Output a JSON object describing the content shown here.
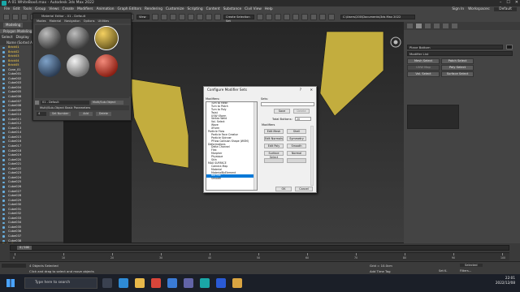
{
  "window": {
    "title": "A 01 WhiteBox4.max - Autodesk 3ds Max 2022",
    "controls": [
      "–",
      "☐",
      "✕"
    ]
  },
  "menubar": {
    "items": [
      "File",
      "Edit",
      "Tools",
      "Group",
      "Views",
      "Create",
      "Modifiers",
      "Animation",
      "Graph Editors",
      "Rendering",
      "Customize",
      "Scripting",
      "Content",
      "Substance",
      "Civil View",
      "Help"
    ],
    "sign_in": "Sign In",
    "workspaces_label": "Workspaces:",
    "workspaces_value": "Default"
  },
  "toolbar": {
    "filter_value": "All",
    "view_value": "View",
    "selection_set_placeholder": "Create Selection Set",
    "path": "C:\\Users\\200\\Documents\\3ds Max 2022"
  },
  "ribbon": {
    "tabs": [
      "Modeling"
    ],
    "sub": "Polygon Modeling"
  },
  "scene_explorer": {
    "tabs": [
      "Select",
      "Display",
      "Ed"
    ],
    "header": "Name (Sorted Ascending)",
    "items": [
      {
        "label": "Brick01",
        "selected": true
      },
      {
        "label": "Brick02",
        "selected": true
      },
      {
        "label": "Brick03",
        "selected": true
      },
      {
        "label": "Brick04",
        "selected": true
      },
      {
        "label": "Brick05",
        "selected": true
      },
      {
        "label": "Cone_01",
        "selected": false
      },
      {
        "label": "Cube001",
        "selected": false
      },
      {
        "label": "Cube002",
        "selected": false
      },
      {
        "label": "Cube003",
        "selected": false
      },
      {
        "label": "Cube004",
        "selected": false
      },
      {
        "label": "Cube005",
        "selected": false
      },
      {
        "label": "Cube006",
        "selected": false
      },
      {
        "label": "Cube007",
        "selected": false
      },
      {
        "label": "Cube008",
        "selected": false
      },
      {
        "label": "Cube009",
        "selected": false
      },
      {
        "label": "Cube010",
        "selected": false
      },
      {
        "label": "Cube011",
        "selected": false
      },
      {
        "label": "Cube012",
        "selected": false
      },
      {
        "label": "Cube013",
        "selected": false
      },
      {
        "label": "Cube014",
        "selected": false
      },
      {
        "label": "Cube015",
        "selected": false
      },
      {
        "label": "Cube016",
        "selected": false
      },
      {
        "label": "Cube017",
        "selected": false
      },
      {
        "label": "Cube018",
        "selected": false
      },
      {
        "label": "Cube019",
        "selected": false
      },
      {
        "label": "Cube020",
        "selected": false
      },
      {
        "label": "Cube021",
        "selected": false
      },
      {
        "label": "Cube022",
        "selected": false
      },
      {
        "label": "Cube023",
        "selected": false
      },
      {
        "label": "Cube024",
        "selected": false
      },
      {
        "label": "Cube025",
        "selected": false
      },
      {
        "label": "Cube026",
        "selected": false
      },
      {
        "label": "Cube027",
        "selected": false
      },
      {
        "label": "Cube028",
        "selected": false
      },
      {
        "label": "Cube029",
        "selected": false
      },
      {
        "label": "Cube030",
        "selected": false
      },
      {
        "label": "Cube031",
        "selected": false
      },
      {
        "label": "Cube032",
        "selected": false
      },
      {
        "label": "Cube033",
        "selected": false
      },
      {
        "label": "Cube034",
        "selected": false
      },
      {
        "label": "Cube035",
        "selected": false
      },
      {
        "label": "Cube036",
        "selected": false
      },
      {
        "label": "Cube037",
        "selected": false
      },
      {
        "label": "Cube038",
        "selected": false
      }
    ],
    "footer": "Default"
  },
  "material_editor": {
    "title": "Material Editor - 01 - Default",
    "menu": [
      "Modes",
      "Material",
      "Navigation",
      "Options",
      "Utilities"
    ],
    "material_name": "01 - Default",
    "material_type": "Multi/Sub-Object",
    "rollout": "Multi/Sub-Object Basic Parameters",
    "count": "4",
    "set_number": "Set Number",
    "add": "Add",
    "delete": "Delete"
  },
  "dialog": {
    "title": "Configure Modifier Sets",
    "help": "?",
    "close": "✕",
    "modifiers_label": "Modifiers:",
    "sets_label": "Sets:",
    "save": "Save",
    "delete": "Delete",
    "total_buttons_label": "Total Buttons:",
    "total_buttons_value": "20",
    "modifiers_group": "Modifiers",
    "grid_buttons": [
      "Edit Mesh",
      "Shell",
      "Edit Normals",
      "Symmetry",
      "Edit Poly",
      "Smooth",
      "Surface Select",
      "Normal",
      "",
      ""
    ],
    "list": [
      {
        "label": "Turn to Mesh",
        "cat": false,
        "selected": false
      },
      {
        "label": "Turn to Patch",
        "cat": false,
        "selected": false
      },
      {
        "label": "Turn to Poly",
        "cat": false,
        "selected": false
      },
      {
        "label": "Twist",
        "cat": false,
        "selected": false
      },
      {
        "label": "UVW Xform",
        "cat": false,
        "selected": false
      },
      {
        "label": "Vertex Weld",
        "cat": false,
        "selected": false
      },
      {
        "label": "Vol. Select",
        "cat": false,
        "selected": false
      },
      {
        "label": "Wave",
        "cat": false,
        "selected": false
      },
      {
        "label": "XForm",
        "cat": false,
        "selected": false
      },
      {
        "label": "Particle Flow",
        "cat": true,
        "selected": false
      },
      {
        "label": "Particle Face Creator",
        "cat": false,
        "selected": false
      },
      {
        "label": "Particle Skinner",
        "cat": false,
        "selected": false
      },
      {
        "label": "PFlow Collision Shape (WSM)",
        "cat": false,
        "selected": false
      },
      {
        "label": "Deformations",
        "cat": true,
        "selected": false
      },
      {
        "label": "Delta Channel",
        "cat": false,
        "selected": false
      },
      {
        "label": "Flex",
        "cat": false,
        "selected": false
      },
      {
        "label": "Morpher",
        "cat": false,
        "selected": false
      },
      {
        "label": "Physique",
        "cat": false,
        "selected": false
      },
      {
        "label": "Skin",
        "cat": false,
        "selected": false
      },
      {
        "label": "MAX SURFACE",
        "cat": true,
        "selected": false
      },
      {
        "label": "Camera Map",
        "cat": false,
        "selected": false
      },
      {
        "label": "Material",
        "cat": false,
        "selected": false
      },
      {
        "label": "MaterialByElement",
        "cat": false,
        "selected": false
      },
      {
        "label": "Normal",
        "cat": false,
        "selected": true
      },
      {
        "label": "Smooth",
        "cat": false,
        "selected": false
      }
    ],
    "ok": "OK",
    "cancel": "Cancel"
  },
  "command_panel": {
    "name_value": "Plane Bottom",
    "modifier_list": "Modifier List",
    "buttons": [
      "Mesh Select",
      "Patch Select",
      "UVW Map",
      "Poly Select",
      "Vol. Select",
      "Surface Select"
    ]
  },
  "timeline": {
    "frame_display": "0 / 100",
    "ticks": [
      "0",
      "10",
      "20",
      "30",
      "40",
      "50",
      "60",
      "70",
      "80",
      "90",
      "100"
    ]
  },
  "status": {
    "objects_selected": "4 Objects Selected",
    "prompt": "Click and drag to select and move objects",
    "grid": "Grid = 10.0cm",
    "add_time_tag": "Add Time Tag",
    "key_filter": "Selected",
    "set_key": "Set K.",
    "filters": "Filters..."
  },
  "taskbar": {
    "search_placeholder": "Type here to search",
    "time": "22:01",
    "date": "2022/12/08"
  },
  "colors": {
    "accent": "#0078d7",
    "geometry_yellow": "#c8b241",
    "selection_text": "#ffd24a"
  }
}
